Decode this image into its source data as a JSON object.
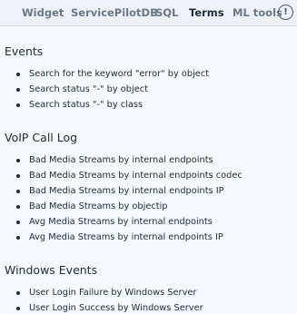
{
  "tabs": [
    {
      "label": "Widget"
    },
    {
      "label": "ServicePilotDB"
    },
    {
      "label": "SQL"
    },
    {
      "label": "Terms"
    },
    {
      "label": "ML tools"
    }
  ],
  "info_button_label": "!",
  "sections": [
    {
      "title": "Events",
      "items": [
        "Search for the keyword \"error\" by object",
        "Search status \"-\" by object",
        "Search status \"-\" by class"
      ]
    },
    {
      "title": "VoIP Call Log",
      "items": [
        "Bad Media Streams by internal endpoints",
        "Bad Media Streams by internal endpoints codec",
        "Bad Media Streams by internal endpoints IP",
        "Bad Media Streams by objectip",
        "Avg Media Streams by internal endpoints",
        "Avg Media Streams by internal endpoints IP"
      ]
    },
    {
      "title": "Windows Events",
      "items": [
        "User Login Failure by Windows Server",
        "User Login Success by Windows Server"
      ]
    }
  ]
}
